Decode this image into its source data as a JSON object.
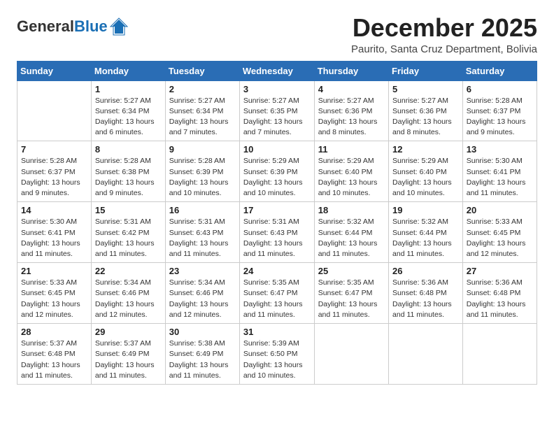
{
  "logo": {
    "general": "General",
    "blue": "Blue"
  },
  "title": "December 2025",
  "subtitle": "Paurito, Santa Cruz Department, Bolivia",
  "weekdays": [
    "Sunday",
    "Monday",
    "Tuesday",
    "Wednesday",
    "Thursday",
    "Friday",
    "Saturday"
  ],
  "weeks": [
    [
      {
        "day": "",
        "info": ""
      },
      {
        "day": "1",
        "info": "Sunrise: 5:27 AM\nSunset: 6:34 PM\nDaylight: 13 hours\nand 6 minutes."
      },
      {
        "day": "2",
        "info": "Sunrise: 5:27 AM\nSunset: 6:34 PM\nDaylight: 13 hours\nand 7 minutes."
      },
      {
        "day": "3",
        "info": "Sunrise: 5:27 AM\nSunset: 6:35 PM\nDaylight: 13 hours\nand 7 minutes."
      },
      {
        "day": "4",
        "info": "Sunrise: 5:27 AM\nSunset: 6:36 PM\nDaylight: 13 hours\nand 8 minutes."
      },
      {
        "day": "5",
        "info": "Sunrise: 5:27 AM\nSunset: 6:36 PM\nDaylight: 13 hours\nand 8 minutes."
      },
      {
        "day": "6",
        "info": "Sunrise: 5:28 AM\nSunset: 6:37 PM\nDaylight: 13 hours\nand 9 minutes."
      }
    ],
    [
      {
        "day": "7",
        "info": "Sunrise: 5:28 AM\nSunset: 6:37 PM\nDaylight: 13 hours\nand 9 minutes."
      },
      {
        "day": "8",
        "info": "Sunrise: 5:28 AM\nSunset: 6:38 PM\nDaylight: 13 hours\nand 9 minutes."
      },
      {
        "day": "9",
        "info": "Sunrise: 5:28 AM\nSunset: 6:39 PM\nDaylight: 13 hours\nand 10 minutes."
      },
      {
        "day": "10",
        "info": "Sunrise: 5:29 AM\nSunset: 6:39 PM\nDaylight: 13 hours\nand 10 minutes."
      },
      {
        "day": "11",
        "info": "Sunrise: 5:29 AM\nSunset: 6:40 PM\nDaylight: 13 hours\nand 10 minutes."
      },
      {
        "day": "12",
        "info": "Sunrise: 5:29 AM\nSunset: 6:40 PM\nDaylight: 13 hours\nand 10 minutes."
      },
      {
        "day": "13",
        "info": "Sunrise: 5:30 AM\nSunset: 6:41 PM\nDaylight: 13 hours\nand 11 minutes."
      }
    ],
    [
      {
        "day": "14",
        "info": "Sunrise: 5:30 AM\nSunset: 6:41 PM\nDaylight: 13 hours\nand 11 minutes."
      },
      {
        "day": "15",
        "info": "Sunrise: 5:31 AM\nSunset: 6:42 PM\nDaylight: 13 hours\nand 11 minutes."
      },
      {
        "day": "16",
        "info": "Sunrise: 5:31 AM\nSunset: 6:43 PM\nDaylight: 13 hours\nand 11 minutes."
      },
      {
        "day": "17",
        "info": "Sunrise: 5:31 AM\nSunset: 6:43 PM\nDaylight: 13 hours\nand 11 minutes."
      },
      {
        "day": "18",
        "info": "Sunrise: 5:32 AM\nSunset: 6:44 PM\nDaylight: 13 hours\nand 11 minutes."
      },
      {
        "day": "19",
        "info": "Sunrise: 5:32 AM\nSunset: 6:44 PM\nDaylight: 13 hours\nand 11 minutes."
      },
      {
        "day": "20",
        "info": "Sunrise: 5:33 AM\nSunset: 6:45 PM\nDaylight: 13 hours\nand 12 minutes."
      }
    ],
    [
      {
        "day": "21",
        "info": "Sunrise: 5:33 AM\nSunset: 6:45 PM\nDaylight: 13 hours\nand 12 minutes."
      },
      {
        "day": "22",
        "info": "Sunrise: 5:34 AM\nSunset: 6:46 PM\nDaylight: 13 hours\nand 12 minutes."
      },
      {
        "day": "23",
        "info": "Sunrise: 5:34 AM\nSunset: 6:46 PM\nDaylight: 13 hours\nand 12 minutes."
      },
      {
        "day": "24",
        "info": "Sunrise: 5:35 AM\nSunset: 6:47 PM\nDaylight: 13 hours\nand 11 minutes."
      },
      {
        "day": "25",
        "info": "Sunrise: 5:35 AM\nSunset: 6:47 PM\nDaylight: 13 hours\nand 11 minutes."
      },
      {
        "day": "26",
        "info": "Sunrise: 5:36 AM\nSunset: 6:48 PM\nDaylight: 13 hours\nand 11 minutes."
      },
      {
        "day": "27",
        "info": "Sunrise: 5:36 AM\nSunset: 6:48 PM\nDaylight: 13 hours\nand 11 minutes."
      }
    ],
    [
      {
        "day": "28",
        "info": "Sunrise: 5:37 AM\nSunset: 6:48 PM\nDaylight: 13 hours\nand 11 minutes."
      },
      {
        "day": "29",
        "info": "Sunrise: 5:37 AM\nSunset: 6:49 PM\nDaylight: 13 hours\nand 11 minutes."
      },
      {
        "day": "30",
        "info": "Sunrise: 5:38 AM\nSunset: 6:49 PM\nDaylight: 13 hours\nand 11 minutes."
      },
      {
        "day": "31",
        "info": "Sunrise: 5:39 AM\nSunset: 6:50 PM\nDaylight: 13 hours\nand 10 minutes."
      },
      {
        "day": "",
        "info": ""
      },
      {
        "day": "",
        "info": ""
      },
      {
        "day": "",
        "info": ""
      }
    ]
  ]
}
